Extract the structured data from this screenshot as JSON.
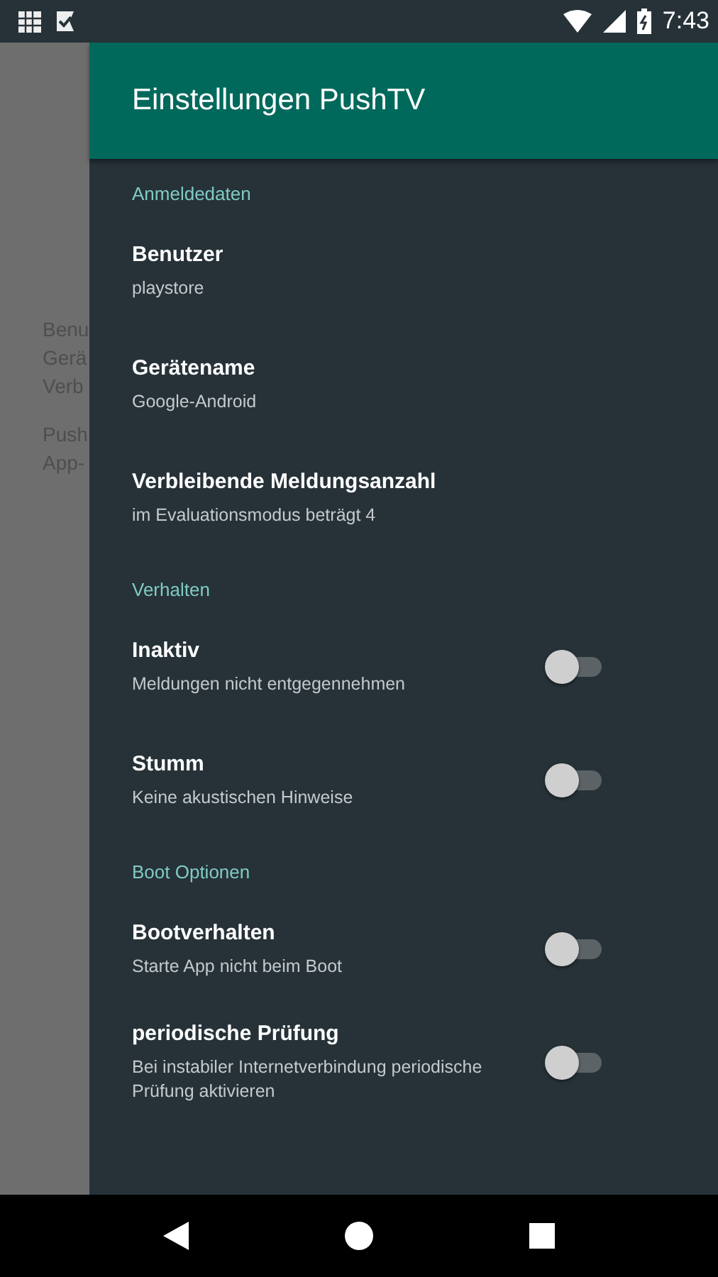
{
  "status_bar": {
    "time": "7:43"
  },
  "background_lines": [
    [
      "Benu",
      "Gerä",
      "Verb"
    ],
    [
      "Push",
      "App-"
    ]
  ],
  "drawer": {
    "title": "Einstellungen PushTV",
    "sections": [
      {
        "header": "Anmeldedaten",
        "items": [
          {
            "kind": "text",
            "title": "Benutzer",
            "summary": "playstore"
          },
          {
            "kind": "text",
            "title": "Gerätename",
            "summary": "Google-Android"
          },
          {
            "kind": "text",
            "title": "Verbleibende Meldungsanzahl",
            "summary": "im Evaluationsmodus beträgt 4"
          }
        ]
      },
      {
        "header": "Verhalten",
        "items": [
          {
            "kind": "switch",
            "title": "Inaktiv",
            "summary": "Meldungen nicht entgegennehmen",
            "on": false
          },
          {
            "kind": "switch",
            "title": "Stumm",
            "summary": "Keine akustischen Hinweise",
            "on": false
          }
        ]
      },
      {
        "header": "Boot Optionen",
        "items": [
          {
            "kind": "switch",
            "title": "Bootverhalten",
            "summary": "Starte App nicht beim Boot",
            "on": false
          },
          {
            "kind": "switch",
            "title": "periodische Prüfung",
            "summary": "Bei instabiler Internetverbindung periodische Prüfung aktivieren",
            "on": false
          }
        ]
      }
    ]
  }
}
